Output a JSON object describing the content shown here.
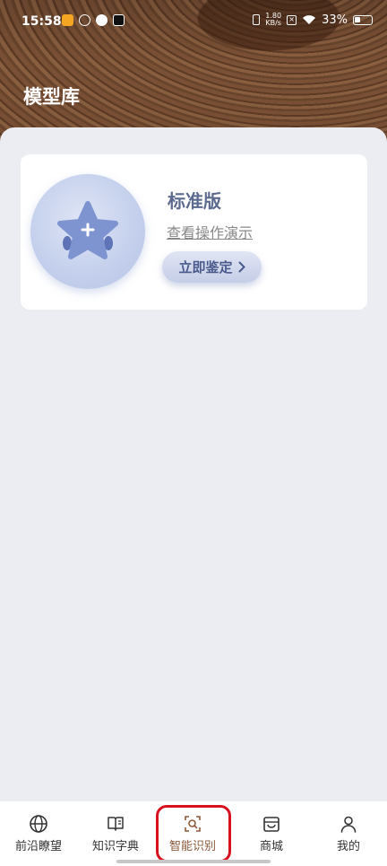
{
  "status_bar": {
    "time": "15:58",
    "net_speed_value": "1.80",
    "net_speed_unit": "KB/s",
    "battery": "33%"
  },
  "header": {
    "title": "模型库"
  },
  "model_card": {
    "title": "标准版",
    "demo_link": "查看操作演示",
    "identify_button": "立即鉴定"
  },
  "tabbar": {
    "tabs": [
      {
        "label": "前沿瞭望",
        "icon": "globe-icon"
      },
      {
        "label": "知识字典",
        "icon": "book-icon"
      },
      {
        "label": "智能识别",
        "icon": "scan-icon",
        "active": true
      },
      {
        "label": "商城",
        "icon": "store-icon"
      },
      {
        "label": "我的",
        "icon": "user-icon"
      }
    ]
  },
  "colors": {
    "accent": "#8c5a3c",
    "card_title": "#5c6a8f",
    "highlight": "#d9111e"
  }
}
